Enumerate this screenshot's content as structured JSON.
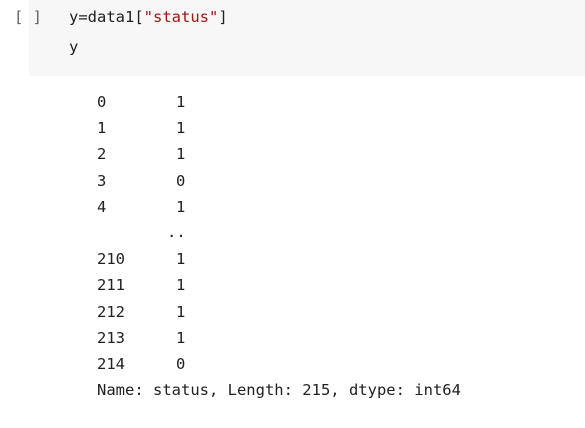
{
  "cell": {
    "run_indicator": "[ ]",
    "code_prefix": "y=data1[",
    "code_string": "\"status\"",
    "code_suffix": "]",
    "code_line2": "y"
  },
  "output": {
    "head_rows": [
      {
        "index": "0",
        "value": "1"
      },
      {
        "index": "1",
        "value": "1"
      },
      {
        "index": "2",
        "value": "1"
      },
      {
        "index": "3",
        "value": "0"
      },
      {
        "index": "4",
        "value": "1"
      }
    ],
    "ellipsis": "..",
    "tail_rows": [
      {
        "index": "210",
        "value": "1"
      },
      {
        "index": "211",
        "value": "1"
      },
      {
        "index": "212",
        "value": "1"
      },
      {
        "index": "213",
        "value": "1"
      },
      {
        "index": "214",
        "value": "0"
      }
    ],
    "footer": "Name: status, Length: 215, dtype: int64"
  }
}
